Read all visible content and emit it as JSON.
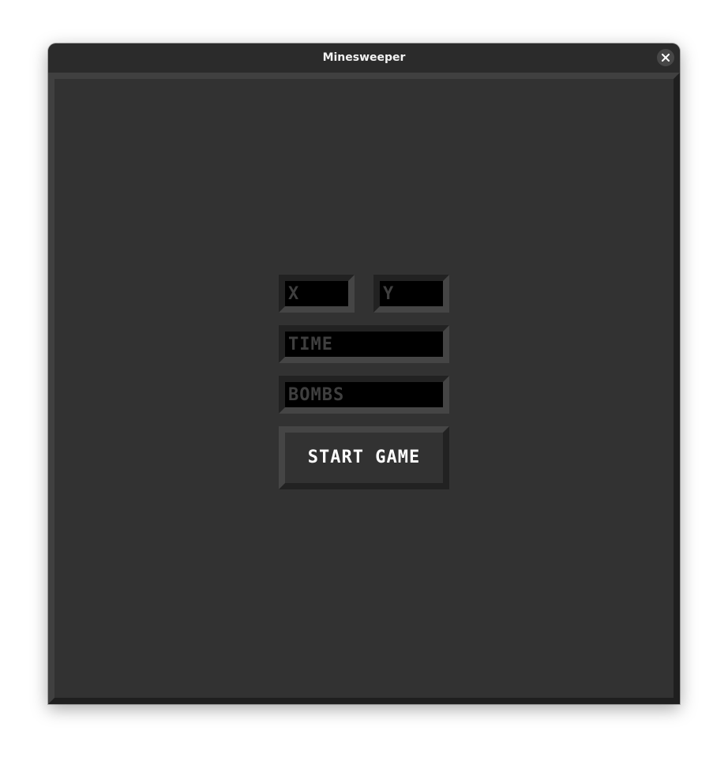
{
  "window": {
    "title": "Minesweeper",
    "close_icon": "close-icon"
  },
  "form": {
    "x_placeholder": "X",
    "y_placeholder": "Y",
    "time_placeholder": "TIME",
    "bombs_placeholder": "BOMBS",
    "start_label": "START GAME"
  },
  "colors": {
    "background": "#323232",
    "field_fill": "#000000",
    "placeholder_text": "#3f3f3f",
    "button_text": "#ffffff"
  }
}
